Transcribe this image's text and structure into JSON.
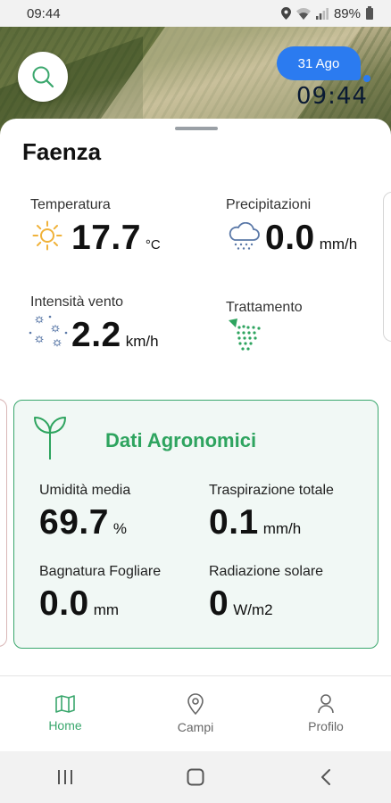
{
  "status_bar": {
    "time": "09:44",
    "battery": "89%"
  },
  "map": {
    "date": "31 Ago",
    "time": "09:44"
  },
  "location": {
    "name": "Faenza"
  },
  "weather": {
    "temperature": {
      "label": "Temperatura",
      "value": "17.7",
      "unit": "°C"
    },
    "precipitation": {
      "label": "Precipitazioni",
      "value": "0.0",
      "unit": "mm/h"
    },
    "wind": {
      "label": "Intensità vento",
      "value": "2.2",
      "unit": "km/h"
    },
    "treatment": {
      "label": "Trattamento"
    }
  },
  "agronomic": {
    "title": "Dati Agronomici",
    "humidity": {
      "label": "Umidità media",
      "value": "69.7",
      "unit": "%"
    },
    "transpiration": {
      "label": "Traspirazione totale",
      "value": "0.1",
      "unit": "mm/h"
    },
    "leaf_wetness": {
      "label": "Bagnatura Fogliare",
      "value": "0.0",
      "unit": "mm"
    },
    "solar_radiation": {
      "label": "Radiazione solare",
      "value": "0",
      "unit": "W/m2"
    }
  },
  "bottom_nav": {
    "items": [
      {
        "label": "Home",
        "icon": "map-icon",
        "active": true
      },
      {
        "label": "Campi",
        "icon": "pin-icon",
        "active": false
      },
      {
        "label": "Profilo",
        "icon": "person-icon",
        "active": false
      }
    ]
  },
  "colors": {
    "accent_green": "#3aa76d",
    "title_green": "#2ea45f",
    "date_blue": "#2b7bf0"
  }
}
